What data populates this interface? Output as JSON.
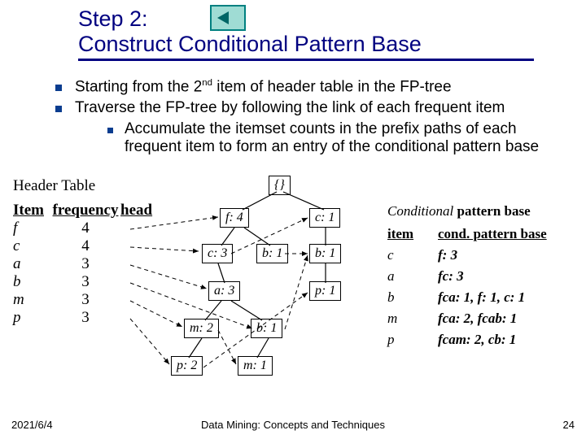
{
  "title": {
    "line1": "Step 2:",
    "line2": "Construct Conditional Pattern Base"
  },
  "bullets": {
    "b1_pre": "Starting from the 2",
    "b1_sup": "nd",
    "b1_post": " item of header table in the FP-tree",
    "b2": "Traverse the FP-tree by following the link of each frequent item",
    "b3": "Accumulate the itemset counts in the prefix paths of each frequent item to form an entry of the conditional pattern base"
  },
  "header_label": "Header Table",
  "item_table": {
    "h1": "Item",
    "h2": "frequency",
    "h3": "head",
    "rows": [
      {
        "i": "f",
        "f": "4"
      },
      {
        "i": "c",
        "f": "4"
      },
      {
        "i": "a",
        "f": "3"
      },
      {
        "i": "b",
        "f": "3"
      },
      {
        "i": "m",
        "f": "3"
      },
      {
        "i": "p",
        "f": "3"
      }
    ]
  },
  "tree": {
    "root": "{}",
    "f4": "f: 4",
    "c1": "c: 1",
    "c3": "c: 3",
    "b1a": "b: 1",
    "b1b": "b: 1",
    "a3": "a: 3",
    "p1": "p: 1",
    "m2": "m: 2",
    "b1c": "b: 1",
    "p2": "p: 2",
    "m1": "m: 1"
  },
  "cpb": {
    "title_italic": "Conditional",
    "title_bold": " pattern base",
    "h1": "item",
    "h2": "cond. pattern base",
    "rows": [
      {
        "i": "c",
        "p": "f: 3"
      },
      {
        "i": "a",
        "p": "fc: 3"
      },
      {
        "i": "b",
        "p": "fca: 1, f: 1, c: 1"
      },
      {
        "i": "m",
        "p": "fca: 2, fcab: 1"
      },
      {
        "i": "p",
        "p": "fcam: 2, cb: 1"
      }
    ]
  },
  "footer": {
    "date": "2021/6/4",
    "center": "Data Mining: Concepts and Techniques",
    "num": "24"
  }
}
